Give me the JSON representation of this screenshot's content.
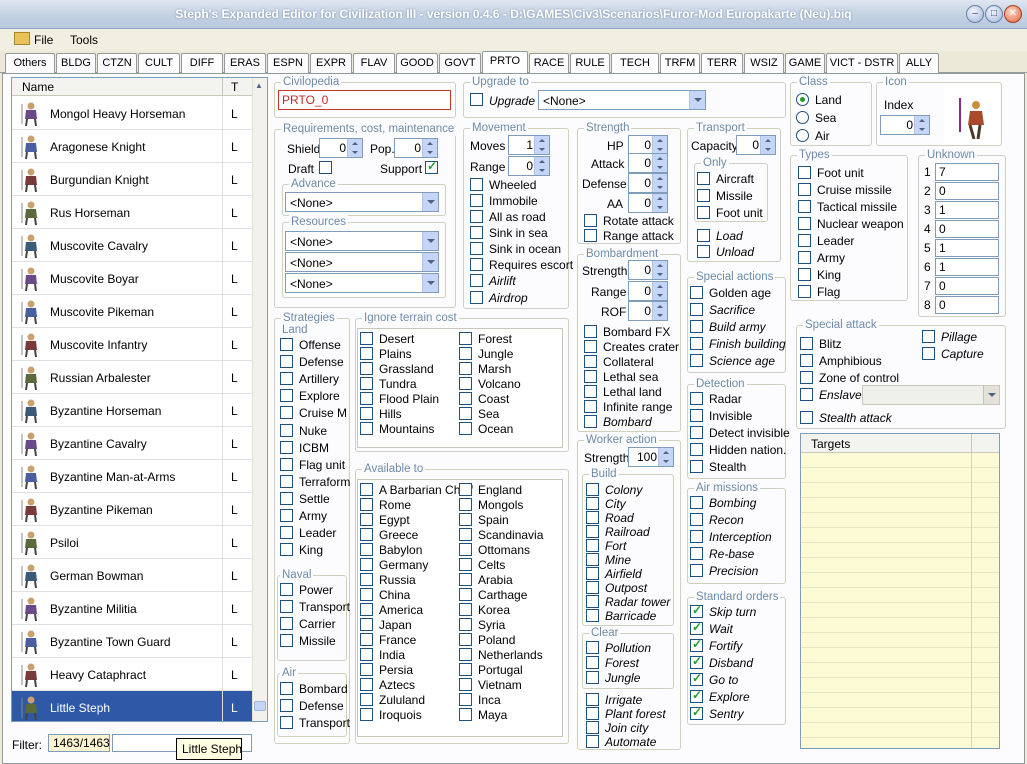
{
  "window": {
    "title": "Steph's Expanded Editor for Civilization III - version 0.4.6 - D:\\GAMES\\Civ3\\Scenarios\\Furor-Mod Europakarte (Neu).biq"
  },
  "menu": {
    "file": "File",
    "tools": "Tools"
  },
  "tabs": [
    "Others",
    "BLDG",
    "CTZN",
    "CULT",
    "DIFF",
    "ERAS",
    "ESPN",
    "EXPR",
    "FLAV",
    "GOOD",
    "GOVT",
    "PRTO",
    "RACE",
    "RULE",
    "TECH",
    "TRFM",
    "TERR",
    "WSIZ",
    "GAME",
    "VICT - DSTR",
    "ALLY"
  ],
  "active_tab": "PRTO",
  "unit_list": {
    "col_name": "Name",
    "col_t": "T",
    "rows": [
      {
        "name": "Mongol Heavy Horseman",
        "t": "L"
      },
      {
        "name": "Aragonese Knight",
        "t": "L"
      },
      {
        "name": "Burgundian Knight",
        "t": "L"
      },
      {
        "name": "Rus Horseman",
        "t": "L"
      },
      {
        "name": "Muscovite Cavalry",
        "t": "L"
      },
      {
        "name": "Muscovite Boyar",
        "t": "L"
      },
      {
        "name": "Muscovite Pikeman",
        "t": "L"
      },
      {
        "name": "Muscovite Infantry",
        "t": "L"
      },
      {
        "name": "Russian Arbalester",
        "t": "L"
      },
      {
        "name": "Byzantine Horseman",
        "t": "L"
      },
      {
        "name": "Byzantine Cavalry",
        "t": "L"
      },
      {
        "name": "Byzantine Man-at-Arms",
        "t": "L"
      },
      {
        "name": "Byzantine Pikeman",
        "t": "L"
      },
      {
        "name": "Psiloi",
        "t": "L"
      },
      {
        "name": "German Bowman",
        "t": "L"
      },
      {
        "name": "Byzantine Militia",
        "t": "L"
      },
      {
        "name": "Byzantine Town Guard",
        "t": "L"
      },
      {
        "name": "Heavy Cataphract",
        "t": "L"
      },
      {
        "name": "Little Steph",
        "t": "L"
      }
    ],
    "selected": "Little Steph"
  },
  "filter": {
    "label": "Filter:",
    "count": "1463/1463",
    "value": "",
    "tooltip": "Little Steph"
  },
  "civilopedia": {
    "legend": "Civilopedia",
    "value": "PRTO_0"
  },
  "upgrade": {
    "legend": "Upgrade to",
    "checkbox": "Upgrade",
    "value": "<None>"
  },
  "requirements": {
    "legend": "Requirements, cost, maintenance",
    "shield_label": "Shield",
    "shield": "0",
    "pop_label": "Pop.",
    "pop": "0",
    "draft": "Draft",
    "support": "Support"
  },
  "advance": {
    "legend": "Advance",
    "value": "<None>"
  },
  "resources": {
    "legend": "Resources",
    "values": [
      "<None>",
      "<None>",
      "<None>"
    ]
  },
  "movement": {
    "legend": "Movement",
    "moves_label": "Moves",
    "moves": "1",
    "range_label": "Range",
    "range": "0",
    "flags": [
      "Wheeled",
      "Immobile",
      "All as road",
      "Sink in sea",
      "Sink in ocean",
      "Requires escort"
    ],
    "italic_flags": [
      "Airlift",
      "Airdrop"
    ]
  },
  "strength": {
    "legend": "Strength",
    "hp_label": "HP",
    "hp": "0",
    "attack_label": "Attack",
    "attack": "0",
    "defense_label": "Defense",
    "defense": "0",
    "aa_label": "AA",
    "aa": "0",
    "flags": [
      "Rotate attack",
      "Range attack"
    ]
  },
  "bombardment": {
    "legend": "Bombardment",
    "strength_label": "Strength",
    "strength": "0",
    "range_label": "Range",
    "range": "0",
    "rof_label": "ROF",
    "rof": "0",
    "flags": [
      "Bombard FX",
      "Creates crater",
      "Collateral",
      "Lethal sea",
      "Lethal land",
      "Infinite range"
    ],
    "italic_flags": [
      "Bombard"
    ]
  },
  "transport": {
    "legend": "Transport",
    "capacity_label": "Capacity",
    "capacity": "0",
    "only_legend": "Only",
    "only": [
      "Aircraft",
      "Missile",
      "Foot unit"
    ],
    "italic": [
      "Load",
      "Unload"
    ]
  },
  "class": {
    "legend": "Class",
    "options": [
      "Land",
      "Sea",
      "Air"
    ],
    "selected": "Land"
  },
  "icon": {
    "legend": "Icon",
    "index_label": "Index",
    "index": "0"
  },
  "types": {
    "legend": "Types",
    "items": [
      "Foot unit",
      "Cruise missile",
      "Tactical missile",
      "Nuclear weapon",
      "Leader",
      "Army",
      "King",
      "Flag"
    ]
  },
  "unknown": {
    "legend": "Unknown",
    "rows": [
      {
        "n": "1",
        "v": "7"
      },
      {
        "n": "2",
        "v": "0"
      },
      {
        "n": "3",
        "v": "1"
      },
      {
        "n": "4",
        "v": "0"
      },
      {
        "n": "5",
        "v": "1"
      },
      {
        "n": "6",
        "v": "1"
      },
      {
        "n": "7",
        "v": "0"
      },
      {
        "n": "8",
        "v": "0"
      }
    ]
  },
  "strategies": {
    "legend": "Strategies",
    "land_legend": "Land",
    "land": [
      "Offense",
      "Defense",
      "Artillery",
      "Explore",
      "Cruise M",
      "Nuke",
      "ICBM",
      "Flag unit",
      "Terraform",
      "Settle",
      "Army",
      "Leader",
      "King"
    ],
    "naval_legend": "Naval",
    "naval": [
      "Power",
      "Transport",
      "Carrier",
      "Missile"
    ],
    "air_legend": "Air",
    "air": [
      "Bombard",
      "Defense",
      "Transport"
    ]
  },
  "terrain": {
    "legend": "Ignore terrain cost",
    "col1": [
      "Desert",
      "Plains",
      "Grassland",
      "Tundra",
      "Flood Plain",
      "Hills",
      "Mountains"
    ],
    "col2": [
      "Forest",
      "Jungle",
      "Marsh",
      "Volcano",
      "Coast",
      "Sea",
      "Ocean"
    ]
  },
  "available": {
    "legend": "Available to",
    "col1": [
      "A Barbarian Chief",
      "Rome",
      "Egypt",
      "Greece",
      "Babylon",
      "Germany",
      "Russia",
      "China",
      "America",
      "Japan",
      "France",
      "India",
      "Persia",
      "Aztecs",
      "Zululand",
      "Iroquois"
    ],
    "col2": [
      "England",
      "Mongols",
      "Spain",
      "Scandinavia",
      "Ottomans",
      "Celts",
      "Arabia",
      "Carthage",
      "Korea",
      "Syria",
      "Poland",
      "Netherlands",
      "Portugal",
      "Vietnam",
      "Inca",
      "Maya"
    ]
  },
  "worker": {
    "legend": "Worker action",
    "strength_label": "Strength",
    "strength": "100",
    "build_legend": "Build",
    "build": [
      "Colony",
      "City",
      "Road",
      "Railroad",
      "Fort",
      "Mine",
      "Airfield",
      "Outpost",
      "Radar tower",
      "Barricade"
    ],
    "clear_legend": "Clear",
    "clear": [
      "Pollution",
      "Forest",
      "Jungle"
    ],
    "other": [
      "Irrigate",
      "Plant forest",
      "Join city",
      "Automate"
    ]
  },
  "special_actions": {
    "legend": "Special actions",
    "plain": [
      "Golden age"
    ],
    "italic": [
      "Sacrifice",
      "Build army",
      "Finish building",
      "Science age"
    ]
  },
  "detection": {
    "legend": "Detection",
    "items": [
      "Radar",
      "Invisible",
      "Detect invisible",
      "Hidden nation.",
      "Stealth"
    ]
  },
  "air_missions": {
    "legend": "Air missions",
    "items": [
      "Bombing",
      "Recon",
      "Interception",
      "Re-base",
      "Precision"
    ]
  },
  "standard_orders": {
    "legend": "Standard orders",
    "items": [
      "Skip turn",
      "Wait",
      "Fortify",
      "Disband",
      "Go to",
      "Explore",
      "Sentry"
    ]
  },
  "special_attack": {
    "legend": "Special attack",
    "items": [
      "Blitz",
      "Amphibious",
      "Zone of control"
    ],
    "enslave": "Enslave",
    "stealth": "Stealth attack",
    "pillage": "Pillage",
    "capture": "Capture"
  },
  "targets": {
    "header": "Targets"
  },
  "colors": {
    "selection": "#2f58a6",
    "legend": "#6d8ba8",
    "accent": "#c4d5f7"
  }
}
